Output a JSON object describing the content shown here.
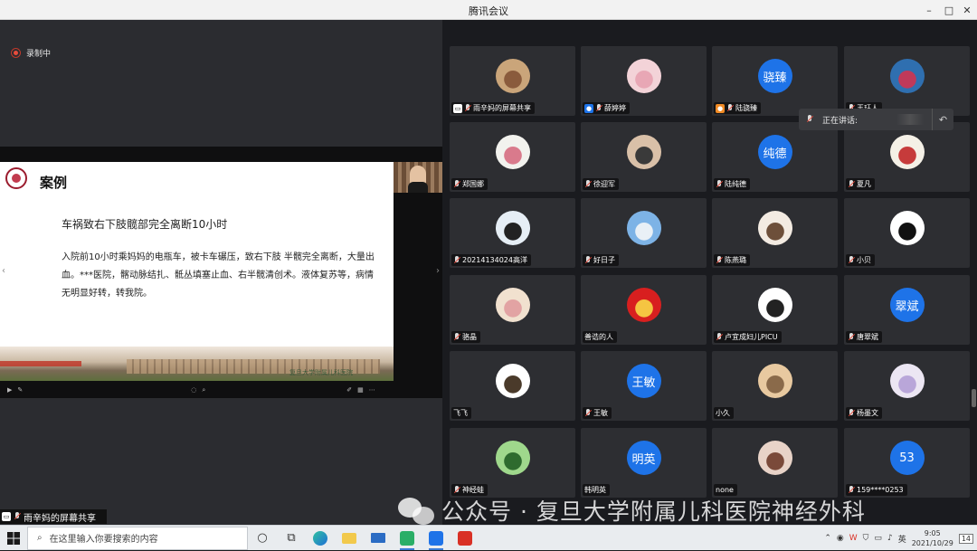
{
  "window": {
    "title": "腾讯会议",
    "minimize": "–",
    "maximize": "□",
    "close": "✕"
  },
  "recording": {
    "label": "录制中"
  },
  "slide": {
    "heading": "案例",
    "subtitle": "车祸致右下肢髋部完全离断10小时",
    "body": "入院前10小时乘妈妈的电瓶车，被卡车碾压，致右下肢 半髋完全离断，大量出血。***医院，髂动脉结扎、骶丛填塞止血、右半髋清创术。液体复苏等，病情无明显好转，转我院。",
    "campus_text": "复旦大学附属儿科医院",
    "prev_arrow": "‹",
    "next_arrow": "›"
  },
  "share_label": "雨辛妈的屏幕共享",
  "speaking": {
    "label": "正在讲话:",
    "back_icon": "↶"
  },
  "participants": [
    {
      "name": "雨辛妈的屏幕共享",
      "avatar": "photo",
      "colors": [
        "#caa57a",
        "#8a5b3c"
      ],
      "badge": "screen"
    },
    {
      "name": "薛婷婷",
      "avatar": "photo",
      "colors": [
        "#f3d3d8",
        "#e8a7b5"
      ],
      "badge": "user"
    },
    {
      "name": "陆骁臻",
      "avatar": "text",
      "avatar_text": "骁臻",
      "badge": "orange"
    },
    {
      "name": "王珏人",
      "avatar": "photo",
      "colors": [
        "#2f6fb0",
        "#c0395a"
      ],
      "badge": ""
    },
    {
      "name": "郑国娜",
      "avatar": "photo",
      "colors": [
        "#f2f2ee",
        "#d97a8c"
      ],
      "badge": ""
    },
    {
      "name": "徐迎军",
      "avatar": "photo",
      "colors": [
        "#d9c0a8",
        "#3a3a3a"
      ],
      "badge": ""
    },
    {
      "name": "陆纯德",
      "avatar": "text",
      "avatar_text": "纯德",
      "badge": ""
    },
    {
      "name": "夏凡",
      "avatar": "photo",
      "colors": [
        "#f4f0e6",
        "#c63b3b"
      ],
      "badge": ""
    },
    {
      "name": "20214134024高洋",
      "avatar": "photo",
      "colors": [
        "#e6eef5",
        "#222"
      ],
      "badge": ""
    },
    {
      "name": "好日子",
      "avatar": "photo",
      "colors": [
        "#7db3e6",
        "#e9f0f6"
      ],
      "badge": ""
    },
    {
      "name": "陈燕璐",
      "avatar": "photo",
      "colors": [
        "#f3ebe2",
        "#6d4f3a"
      ],
      "badge": ""
    },
    {
      "name": "小贝",
      "avatar": "photo",
      "colors": [
        "#ffffff",
        "#111111"
      ],
      "badge": ""
    },
    {
      "name": "骆晶",
      "avatar": "photo",
      "colors": [
        "#f1e1cf",
        "#e2a3a3"
      ],
      "badge": ""
    },
    {
      "name": "善诰的人",
      "avatar": "photo",
      "colors": [
        "#d81f1f",
        "#f5c542"
      ],
      "badge": "none-mic"
    },
    {
      "name": "卢宜成妇儿PICU",
      "avatar": "photo",
      "colors": [
        "#ffffff",
        "#222222"
      ],
      "badge": ""
    },
    {
      "name": "唐翠斌",
      "avatar": "text",
      "avatar_text": "翠斌",
      "badge": ""
    },
    {
      "name": "飞飞",
      "avatar": "photo",
      "colors": [
        "#ffffff",
        "#4a3a2a"
      ],
      "badge": "none-mic"
    },
    {
      "name": "王敏",
      "avatar": "text",
      "avatar_text": "王敏",
      "badge": ""
    },
    {
      "name": "小久",
      "avatar": "photo",
      "colors": [
        "#e8c9a0",
        "#8a6a4a"
      ],
      "badge": "none-mic"
    },
    {
      "name": "杨墨文",
      "avatar": "photo",
      "colors": [
        "#ece6f3",
        "#b9a6d9"
      ],
      "badge": ""
    },
    {
      "name": "神经蛙",
      "avatar": "photo",
      "colors": [
        "#9fd88c",
        "#2e6b2e"
      ],
      "badge": ""
    },
    {
      "name": "韩明英",
      "avatar": "text",
      "avatar_text": "明英",
      "badge": "none-mic"
    },
    {
      "name": "none",
      "avatar": "photo",
      "colors": [
        "#e8d3c8",
        "#7a4a3a"
      ],
      "badge": "none-mic"
    },
    {
      "name": "159****0253",
      "avatar": "text",
      "avatar_text": "53",
      "badge": ""
    }
  ],
  "watermark": {
    "text": "公众号 · 复旦大学附属儿科医院神经外科"
  },
  "taskbar": {
    "search_placeholder": "在这里输入你要搜索的内容",
    "time": "9:05",
    "date": "2021/10/29",
    "notification_count": "14"
  },
  "colors": {
    "accent": "#1e73e8",
    "recording": "#e74c3c"
  }
}
